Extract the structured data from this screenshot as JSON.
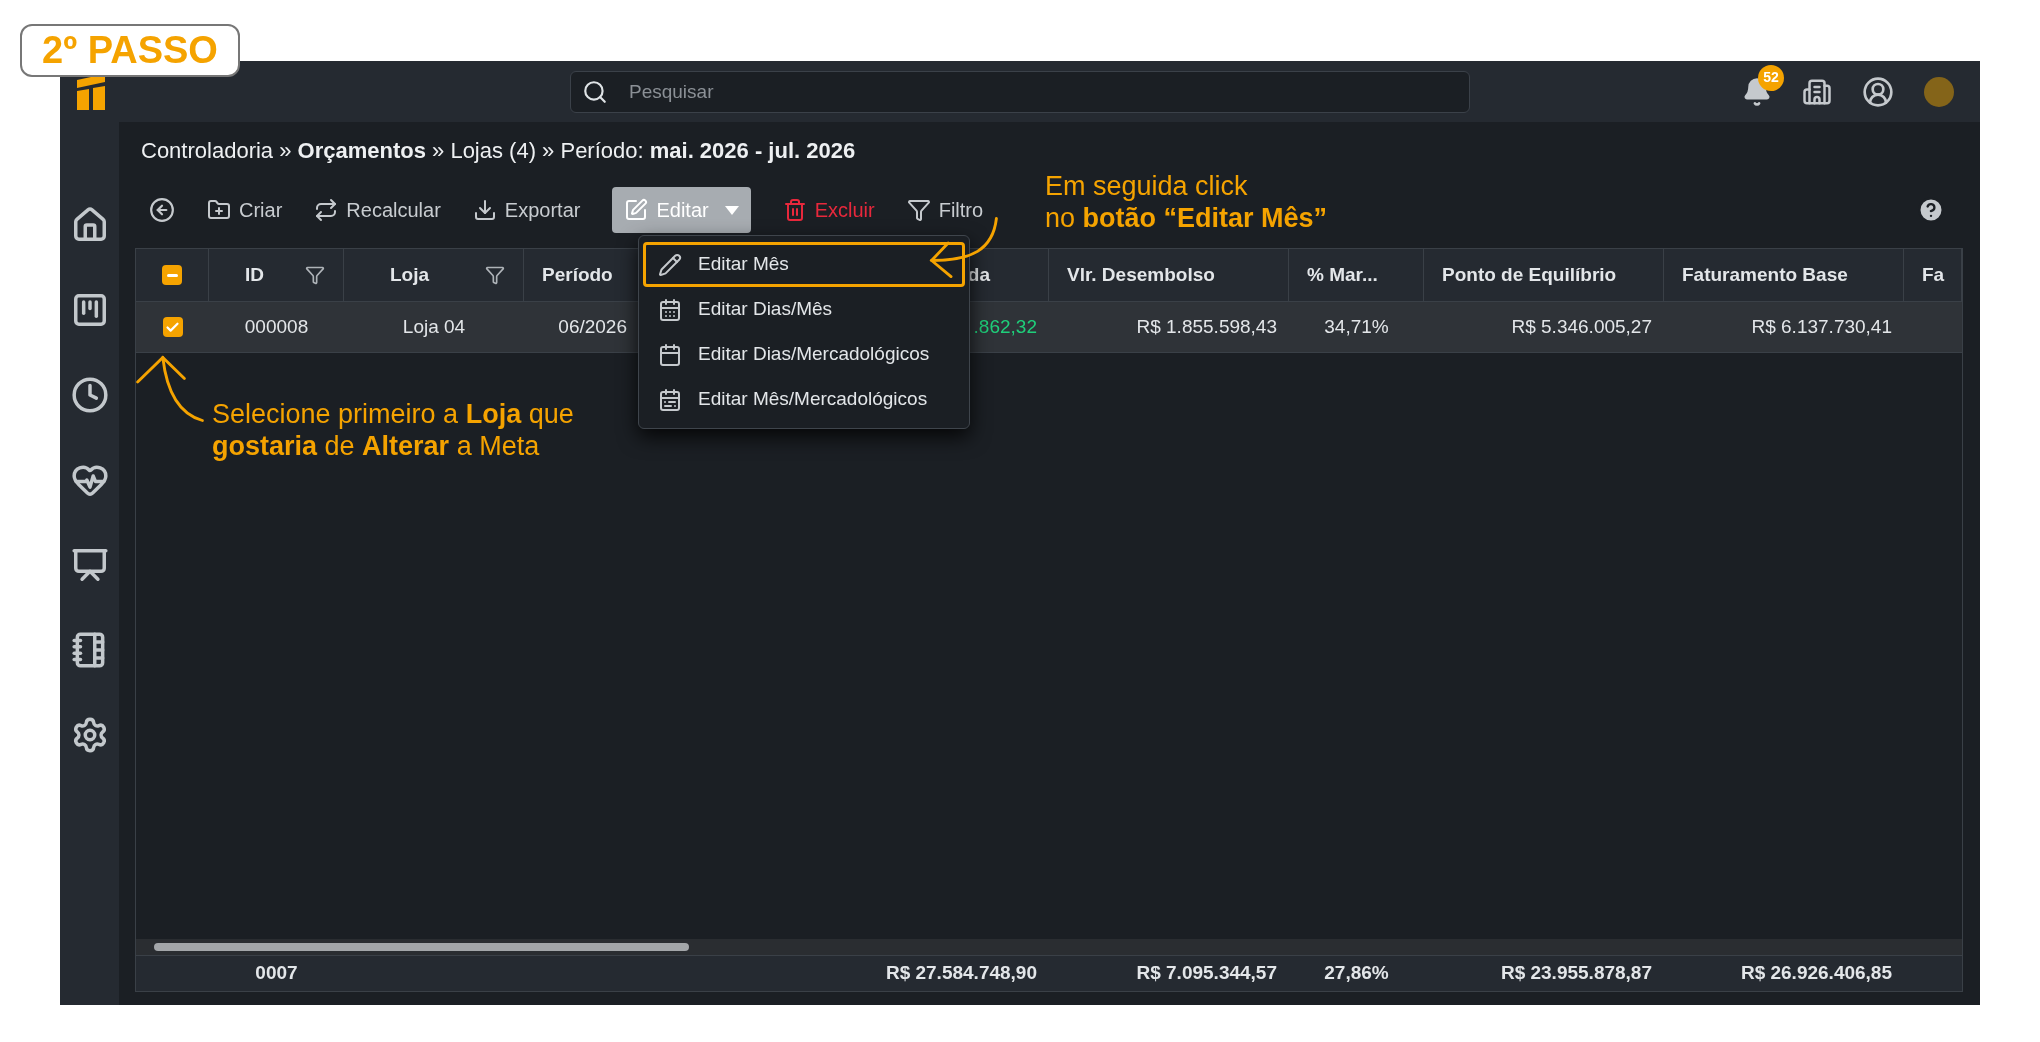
{
  "step_badge": "2º PASSO",
  "header": {
    "search": {
      "placeholder": "Pesquisar"
    },
    "notifications": "52"
  },
  "breadcrumb": "Controladoria » **Orçamentos** » Lojas (4) » Período: **mai. 2026 - jul. 2026**",
  "toolbar": [
    {
      "kind": "back"
    },
    {
      "kind": "create",
      "label": "Criar"
    },
    {
      "kind": "recalc",
      "label": "Recalcular"
    },
    {
      "kind": "export",
      "label": "Exportar"
    },
    {
      "kind": "edit",
      "label": "Editar",
      "expanded": true
    },
    {
      "kind": "delete",
      "label": "Excluir"
    },
    {
      "kind": "filter",
      "label": "Filtro"
    }
  ],
  "edit_menu": [
    {
      "kind": "pencil",
      "label": "Editar Mês",
      "highlighted": true
    },
    {
      "kind": "calendar-days",
      "label": "Editar Dias/Mês",
      "highlighted": false
    },
    {
      "kind": "calendar-blank",
      "label": "Editar Dias/Mercadológicos",
      "highlighted": false
    },
    {
      "kind": "calendar-grid",
      "label": "Editar Mês/Mercadológicos",
      "highlighted": false
    }
  ],
  "table": {
    "select_all": {
      "indeterminate": true
    },
    "columns": [
      {
        "label": "ID",
        "filter": true
      },
      {
        "label": "Loja",
        "filter": true
      },
      {
        "label": "Período",
        "filter": false
      },
      {
        "label": "da",
        "filter": false
      },
      {
        "label": "Vlr. Desembolso",
        "filter": false
      },
      {
        "label": "% Mar...",
        "filter": false
      },
      {
        "label": "Ponto de Equilíbrio",
        "filter": false
      },
      {
        "label": "Faturamento Base",
        "filter": false
      },
      {
        "label": "Fa"
      }
    ],
    "rows": [
      {
        "selected": true,
        "cells": [
          {
            "text": "000008",
            "positive": false
          },
          {
            "text": "Loja 04",
            "positive": false
          },
          {
            "text": "06/2026",
            "positive": false
          },
          {
            "text": ".862,32",
            "positive": true
          },
          {
            "text": "R$ 1.855.598,43",
            "positive": false
          },
          {
            "text": "34,71%",
            "positive": false
          },
          {
            "text": "R$ 5.346.005,27",
            "positive": false
          },
          {
            "text": "R$ 6.137.730,41",
            "positive": false
          }
        ]
      }
    ],
    "totals": [
      "0007",
      "R$ 27.584.748,90",
      "R$ 7.095.344,57",
      "27,86%",
      "R$ 23.955.878,87",
      "R$ 26.926.406,85"
    ]
  },
  "annotations": [
    {
      "kind": "menu",
      "lines": [
        "Em seguida click",
        "no **botão “Editar Mês”**"
      ]
    },
    {
      "kind": "row",
      "lines": [
        "Selecione primeiro a **Loja** que",
        "**gostaria** de **Alterar** a Meta"
      ]
    }
  ]
}
